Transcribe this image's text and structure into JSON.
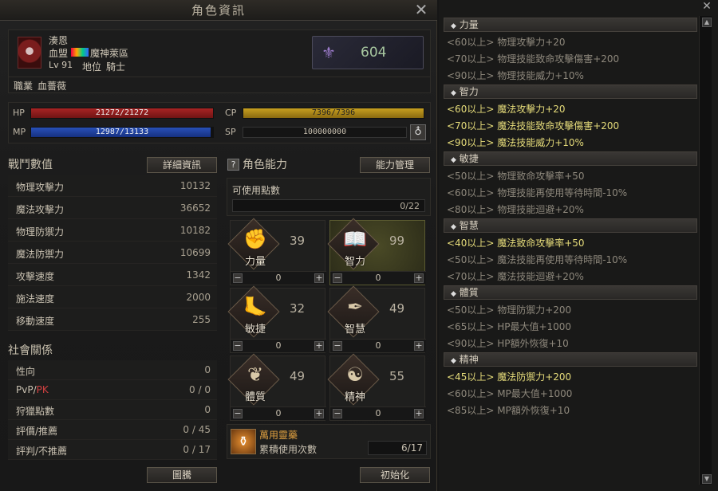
{
  "window": {
    "title": "角色資訊"
  },
  "character": {
    "name": "湊恩",
    "guild_prefix": "血盟",
    "guild_name": "魔神萊區",
    "level": "Lv 91",
    "position_label": "地位",
    "position_value": "騎士",
    "class_label": "職業",
    "class_value": "血薔薇",
    "rank_value": "604"
  },
  "bars": {
    "hp_label": "HP",
    "hp_value": "21272/21272",
    "hp_fill": 1.0,
    "mp_label": "MP",
    "mp_value": "12987/13133",
    "mp_fill": 0.9889,
    "cp_label": "CP",
    "cp_value": "7396/7396",
    "cp_fill": 1.0,
    "sp_label": "SP",
    "sp_value": "100000000"
  },
  "combat": {
    "title": "戰鬥數值",
    "detail_button": "詳細資訊",
    "rows": [
      {
        "k": "物理攻擊力",
        "v": "10132"
      },
      {
        "k": "魔法攻擊力",
        "v": "36652"
      },
      {
        "k": "物理防禦力",
        "v": "10182"
      },
      {
        "k": "魔法防禦力",
        "v": "10699"
      },
      {
        "k": "攻擊速度",
        "v": "1342"
      },
      {
        "k": "施法速度",
        "v": "2000"
      },
      {
        "k": "移動速度",
        "v": "255"
      }
    ]
  },
  "social": {
    "title": "社會關係",
    "rows": [
      {
        "k": "性向",
        "v": "0"
      },
      {
        "k": "PvP/",
        "k2": "PK",
        "v": "0 / 0"
      },
      {
        "k": "狩獵點數",
        "v": "0"
      },
      {
        "k": "評價/推薦",
        "v": "0 / 45"
      },
      {
        "k": "評判/不推薦",
        "v": "0 / 17"
      }
    ],
    "emblem_button": "圖騰"
  },
  "ability": {
    "title": "角色能力",
    "manage_button": "能力管理",
    "points_label": "可使用點數",
    "points_value": "0/22",
    "cells": [
      {
        "label": "力量",
        "value": "39",
        "alloc": "0",
        "icon": "fist-icon"
      },
      {
        "label": "智力",
        "value": "99",
        "alloc": "0",
        "icon": "book-icon"
      },
      {
        "label": "敏捷",
        "value": "32",
        "alloc": "0",
        "icon": "foot-icon"
      },
      {
        "label": "智慧",
        "value": "49",
        "alloc": "0",
        "icon": "feather-icon"
      },
      {
        "label": "體質",
        "value": "49",
        "alloc": "0",
        "icon": "heart-icon"
      },
      {
        "label": "精神",
        "value": "55",
        "alloc": "0",
        "icon": "mind-icon"
      }
    ],
    "potion_name": "萬用靈藥",
    "potion_desc": "累積使用次數",
    "potion_count": "6/17",
    "reset_button": "初始化"
  },
  "bonuses": [
    {
      "title": "力量",
      "lines": [
        {
          "t": "<60以上> 物理攻擊力+20",
          "on": false
        },
        {
          "t": "<70以上> 物理技能致命攻擊傷害+200",
          "on": false
        },
        {
          "t": "<90以上> 物理技能威力+10%",
          "on": false
        }
      ]
    },
    {
      "title": "智力",
      "lines": [
        {
          "t": "<60以上> 魔法攻擊力+20",
          "on": true
        },
        {
          "t": "<70以上> 魔法技能致命攻擊傷害+200",
          "on": true
        },
        {
          "t": "<90以上> 魔法技能威力+10%",
          "on": true
        }
      ]
    },
    {
      "title": "敏捷",
      "lines": [
        {
          "t": "<50以上> 物理致命攻擊率+50",
          "on": false
        },
        {
          "t": "<60以上> 物理技能再使用等待時間-10%",
          "on": false
        },
        {
          "t": "<80以上> 物理技能迴避+20%",
          "on": false
        }
      ]
    },
    {
      "title": "智慧",
      "lines": [
        {
          "t": "<40以上> 魔法致命攻擊率+50",
          "on": true
        },
        {
          "t": "<50以上> 魔法技能再使用等待時間-10%",
          "on": false
        },
        {
          "t": "<70以上> 魔法技能迴避+20%",
          "on": false
        }
      ]
    },
    {
      "title": "體質",
      "lines": [
        {
          "t": "<50以上> 物理防禦力+200",
          "on": false
        },
        {
          "t": "<65以上> HP最大值+1000",
          "on": false
        },
        {
          "t": "<90以上> HP額外恢復+10",
          "on": false
        }
      ]
    },
    {
      "title": "精神",
      "lines": [
        {
          "t": "<45以上> 魔法防禦力+200",
          "on": true
        },
        {
          "t": "<60以上> MP最大值+1000",
          "on": false
        },
        {
          "t": "<85以上> MP額外恢復+10",
          "on": false
        }
      ]
    }
  ],
  "colors": {
    "hp": "#8a1c1c",
    "mp": "#1c3f9a",
    "cp": "#a88a1a",
    "active": "#e6dc7a"
  }
}
